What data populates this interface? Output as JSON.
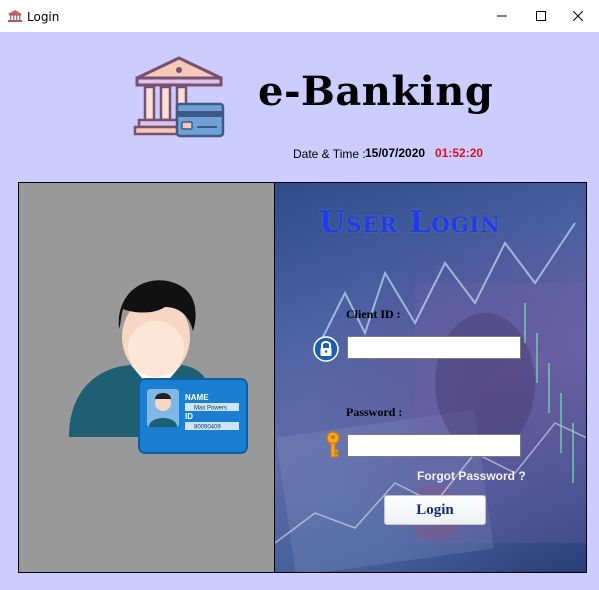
{
  "window": {
    "title": "Login",
    "app_icon": "bank-app-icon"
  },
  "header": {
    "brand": "e-Banking",
    "logo_icon": "bank-card-icon"
  },
  "datetime": {
    "label": "Date & Time :",
    "date": "15/07/2020",
    "time": "01:52:20",
    "time_color": "#d4141f"
  },
  "login": {
    "heading": "User Login",
    "heading_color": "#1e3ce8",
    "client_id_label": "Client ID :",
    "client_id_value": "",
    "password_label": "Password :",
    "password_value": "",
    "forgot_password": "Forgot Password ?",
    "login_button": "Login"
  },
  "colors": {
    "background": "#cccdfe",
    "left_panel": "#999999"
  },
  "avatar_card": {
    "name_label": "NAME",
    "name_value": "Max Powers",
    "id_label": "ID",
    "id_value": "80090409"
  }
}
